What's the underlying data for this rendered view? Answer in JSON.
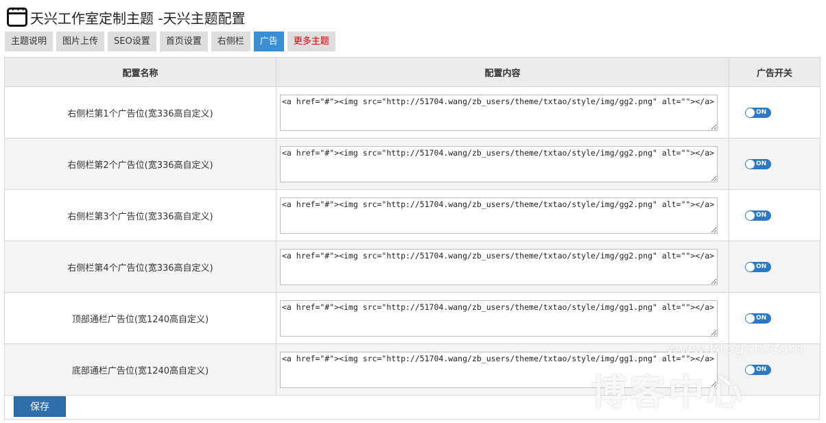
{
  "header": {
    "title": "天兴工作室定制主题 -天兴主题配置"
  },
  "tabs": [
    {
      "label": "主题说明"
    },
    {
      "label": "图片上传"
    },
    {
      "label": "SEO设置"
    },
    {
      "label": "首页设置"
    },
    {
      "label": "右侧栏"
    },
    {
      "label": "广告"
    },
    {
      "label": "更多主题"
    }
  ],
  "table": {
    "headers": [
      "配置名称",
      "配置内容",
      "广告开关"
    ],
    "rows": [
      {
        "name": "右侧栏第1个广告位(宽336高自定义)",
        "content": "<a href=\"#\"><img src=\"http://51704.wang/zb_users/theme/txtao/style/img/gg2.png\" alt=\"\"></a>",
        "toggle": "ON"
      },
      {
        "name": "右侧栏第2个广告位(宽336高自定义)",
        "content": "<a href=\"#\"><img src=\"http://51704.wang/zb_users/theme/txtao/style/img/gg2.png\" alt=\"\"></a>",
        "toggle": "ON"
      },
      {
        "name": "右侧栏第3个广告位(宽336高自定义)",
        "content": "<a href=\"#\"><img src=\"http://51704.wang/zb_users/theme/txtao/style/img/gg2.png\" alt=\"\"></a>",
        "toggle": "ON"
      },
      {
        "name": "右侧栏第4个广告位(宽336高自定义)",
        "content": "<a href=\"#\"><img src=\"http://51704.wang/zb_users/theme/txtao/style/img/gg2.png\" alt=\"\"></a>",
        "toggle": "ON"
      },
      {
        "name": "顶部通栏广告位(宽1240高自定义)",
        "content": "<a href=\"#\"><img src=\"http://51704.wang/zb_users/theme/txtao/style/img/gg1.png\" alt=\"\"></a>",
        "toggle": "ON"
      },
      {
        "name": "底部通栏广告位(宽1240高自定义)",
        "content": "<a href=\"#\"><img src=\"http://51704.wang/zb_users/theme/txtao/style/img/gg1.png\" alt=\"\"></a>",
        "toggle": "ON"
      }
    ]
  },
  "footer": {
    "save_label": "保存"
  },
  "watermark": {
    "url": "www.bIogcn.com",
    "text": "博客中心"
  },
  "colors": {
    "accent": "#3a8fd2",
    "save_button": "#2f6ea8",
    "toggle_on": "#2e78c2",
    "highlight_tab": "#d00000"
  },
  "icons": {
    "title_icon": "window-icon"
  }
}
